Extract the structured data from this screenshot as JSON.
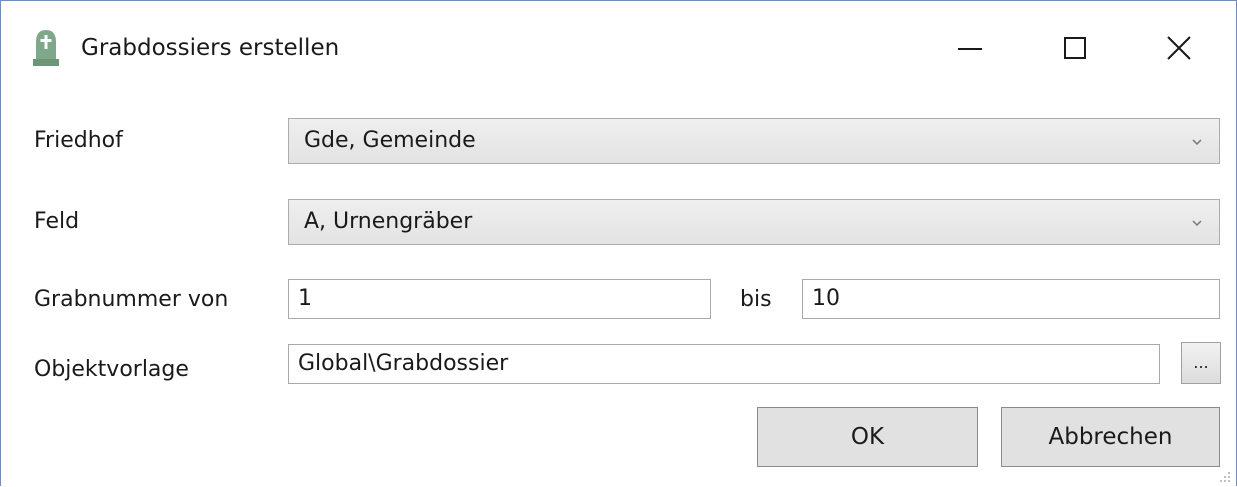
{
  "window": {
    "title": "Grabdossiers erstellen",
    "icon": "gravestone-icon"
  },
  "form": {
    "friedhof": {
      "label": "Friedhof",
      "value": "Gde, Gemeinde"
    },
    "feld": {
      "label": "Feld",
      "value": "A, Urnengräber"
    },
    "grabnummer": {
      "label": "Grabnummer von",
      "from": "1",
      "to_label": "bis",
      "to": "10"
    },
    "objektvorlage": {
      "label": "Objektvorlage",
      "value": "Global\\Grabdossier",
      "browse_label": "..."
    }
  },
  "buttons": {
    "ok": "OK",
    "cancel": "Abbrechen"
  },
  "colors": {
    "icon_green": "#7fa88a",
    "window_border": "#6f8fb8",
    "combo_background": "#e5e5e5",
    "button_background": "#e1e1e1"
  }
}
